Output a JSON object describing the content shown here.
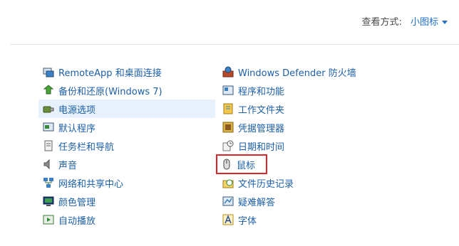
{
  "header": {
    "view_by_label": "查看方式:",
    "view_by_value": "小图标"
  },
  "left_items": [
    {
      "label": "RemoteApp 和桌面连接",
      "icon": "remoteapp-icon"
    },
    {
      "label": "备份和还原(Windows 7)",
      "icon": "backup-icon"
    },
    {
      "label": "电源选项",
      "icon": "power-icon"
    },
    {
      "label": "默认程序",
      "icon": "default-programs-icon"
    },
    {
      "label": "任务栏和导航",
      "icon": "taskbar-icon"
    },
    {
      "label": "声音",
      "icon": "speaker-icon"
    },
    {
      "label": "网络和共享中心",
      "icon": "network-icon"
    },
    {
      "label": "颜色管理",
      "icon": "color-management-icon"
    },
    {
      "label": "自动播放",
      "icon": "autoplay-icon"
    }
  ],
  "right_items": [
    {
      "label": "Windows Defender 防火墙",
      "icon": "firewall-icon"
    },
    {
      "label": "程序和功能",
      "icon": "programs-icon"
    },
    {
      "label": "工作文件夹",
      "icon": "work-folders-icon"
    },
    {
      "label": "凭据管理器",
      "icon": "credential-icon"
    },
    {
      "label": "日期和时间",
      "icon": "clock-icon"
    },
    {
      "label": "鼠标",
      "icon": "mouse-icon"
    },
    {
      "label": "文件历史记录",
      "icon": "file-history-icon"
    },
    {
      "label": "疑难解答",
      "icon": "troubleshoot-icon"
    },
    {
      "label": "字体",
      "icon": "fonts-icon"
    }
  ],
  "colors": {
    "link": "#1d5fa8",
    "highlight": "#e6f1fb",
    "box": "#d9262b"
  }
}
